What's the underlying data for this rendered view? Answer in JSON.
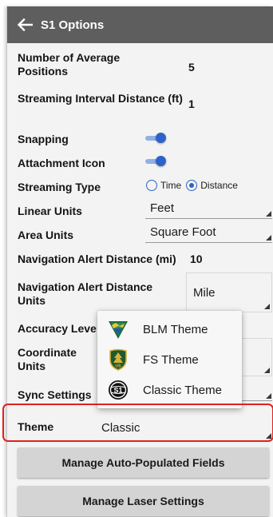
{
  "appbar": {
    "title": "S1 Options"
  },
  "settings": {
    "avg_positions": {
      "label": "Number of Average Positions",
      "value": "5"
    },
    "stream_interval": {
      "label": "Streaming Interval Distance (ft)",
      "value": "1"
    },
    "snapping": {
      "label": "Snapping",
      "on": true
    },
    "attachment_icon": {
      "label": "Attachment Icon",
      "on": true
    },
    "streaming_type": {
      "label": "Streaming Type",
      "options": [
        "Time",
        "Distance"
      ],
      "selected": "Distance"
    },
    "linear_units": {
      "label": "Linear Units",
      "value": "Feet"
    },
    "area_units": {
      "label": "Area Units",
      "value": "Square Foot"
    },
    "nav_alert_distance": {
      "label": "Navigation Alert Distance (mi)",
      "value": "10"
    },
    "nav_alert_units": {
      "label": "Navigation Alert Distance Units",
      "value": "Mile"
    },
    "accuracy_level": {
      "label": "Accuracy Leve"
    },
    "coordinate_units": {
      "label": "Coordinate Units"
    },
    "sync_settings": {
      "label": "Sync Settings"
    },
    "theme": {
      "label": "Theme",
      "value": "Classic"
    }
  },
  "theme_menu": {
    "items": [
      {
        "label": "BLM Theme",
        "icon": "blm-logo-icon"
      },
      {
        "label": "FS Theme",
        "icon": "fs-shield-icon"
      },
      {
        "label": "Classic Theme",
        "icon": "classic-s1-logo-icon"
      }
    ]
  },
  "buttons": {
    "auto_fields": "Manage Auto-Populated Fields",
    "laser": "Manage Laser Settings"
  },
  "colors": {
    "appbar": "#5e5e5e",
    "accent": "#2d63c8",
    "highlight": "#e0211c"
  }
}
